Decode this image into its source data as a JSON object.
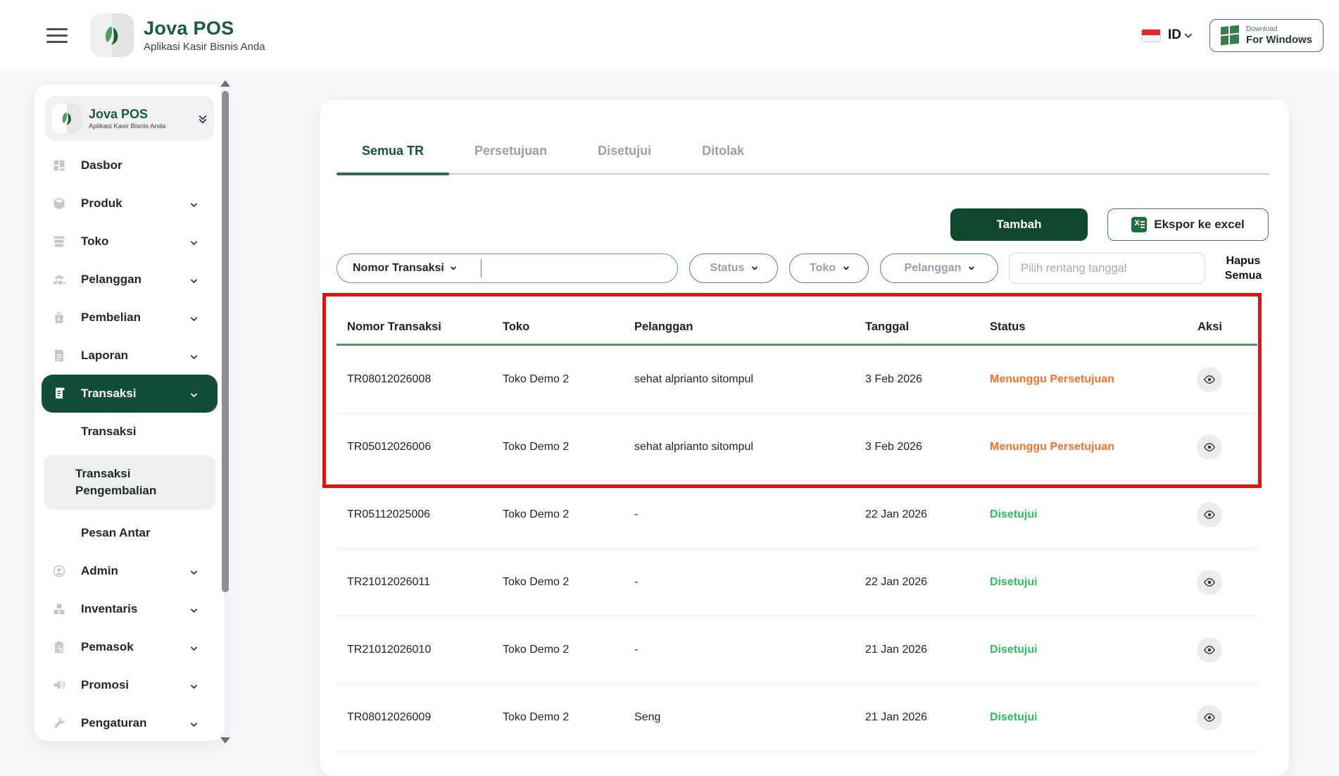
{
  "header": {
    "brand_name": "Jova POS",
    "brand_tagline": "Aplikasi Kasir Bisnis Anda",
    "language": "ID",
    "download_small": "Download",
    "download_large": "For Windows"
  },
  "sidebar": {
    "brand_name": "Jova POS",
    "brand_tagline": "Aplikasi Kasir Bisnis Anda",
    "items_top": [
      {
        "label": "Dasbor"
      },
      {
        "label": "Produk"
      },
      {
        "label": "Toko"
      },
      {
        "label": "Pelanggan"
      },
      {
        "label": "Pembelian"
      },
      {
        "label": "Laporan"
      }
    ],
    "active_item": {
      "label": "Transaksi"
    },
    "submenu": [
      {
        "label": "Transaksi"
      },
      {
        "label": "Transaksi Pengembalian",
        "selected": true
      },
      {
        "label": "Pesan Antar"
      }
    ],
    "items_bottom": [
      {
        "label": "Admin"
      },
      {
        "label": "Inventaris"
      },
      {
        "label": "Pemasok"
      },
      {
        "label": "Promosi"
      },
      {
        "label": "Pengaturan"
      }
    ]
  },
  "main": {
    "tabs": [
      {
        "label": "Semua TR",
        "active": true
      },
      {
        "label": "Persetujuan"
      },
      {
        "label": "Disetujui"
      },
      {
        "label": "Ditolak"
      }
    ],
    "add_button": "Tambah",
    "export_button": "Ekspor ke excel",
    "filters": {
      "field_selector": "Nomor Transaksi",
      "search_value": "",
      "status": "Status",
      "store": "Toko",
      "customer": "Pelanggan",
      "date_placeholder": "Pilih rentang tanggal",
      "clear_all": "Hapus Semua"
    },
    "table": {
      "columns": [
        "Nomor Transaksi",
        "Toko",
        "Pelanggan",
        "Tanggal",
        "Status",
        "Aksi"
      ],
      "rows": [
        {
          "nomor": "TR08012026008",
          "toko": "Toko Demo 2",
          "pelanggan": "sehat alprianto sitompul",
          "tanggal": "3 Feb 2026",
          "status": "Menunggu Persetujuan",
          "highlighted": true
        },
        {
          "nomor": "TR05012026006",
          "toko": "Toko Demo 2",
          "pelanggan": "sehat alprianto sitompul",
          "tanggal": "3 Feb 2026",
          "status": "Menunggu Persetujuan",
          "highlighted": true
        },
        {
          "nomor": "TR05112025006",
          "toko": "Toko Demo 2",
          "pelanggan": "-",
          "tanggal": "22 Jan 2026",
          "status": "Disetujui"
        },
        {
          "nomor": "TR21012026011",
          "toko": "Toko Demo 2",
          "pelanggan": "-",
          "tanggal": "22 Jan 2026",
          "status": "Disetujui"
        },
        {
          "nomor": "TR21012026010",
          "toko": "Toko Demo 2",
          "pelanggan": "-",
          "tanggal": "21 Jan 2026",
          "status": "Disetujui"
        },
        {
          "nomor": "TR08012026009",
          "toko": "Toko Demo 2",
          "pelanggan": "Seng",
          "tanggal": "21 Jan 2026",
          "status": "Disetujui"
        }
      ]
    }
  },
  "colors": {
    "brand_green": "#124d3b",
    "status_pending": "#f9702b",
    "status_approved": "#2bc162",
    "annotation_red": "#e01313"
  }
}
